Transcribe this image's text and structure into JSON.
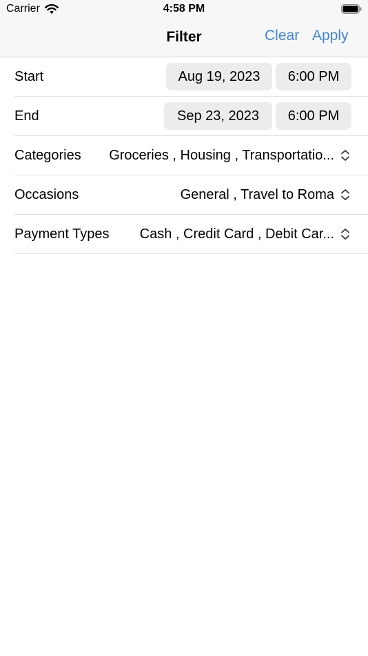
{
  "status": {
    "carrier": "Carrier",
    "time": "4:58 PM"
  },
  "nav": {
    "title": "Filter",
    "clear_label": "Clear",
    "apply_label": "Apply"
  },
  "rows": {
    "start": {
      "label": "Start",
      "date": "Aug 19, 2023",
      "time": "6:00 PM"
    },
    "end": {
      "label": "End",
      "date": "Sep 23, 2023",
      "time": "6:00 PM"
    },
    "categories": {
      "label": "Categories",
      "value": "Groceries , Housing , Transportatio..."
    },
    "occasions": {
      "label": "Occasions",
      "value": "General , Travel to Roma"
    },
    "payment_types": {
      "label": "Payment Types",
      "value": "Cash , Credit Card , Debit Car..."
    }
  },
  "colors": {
    "accent": "#3d84e6",
    "pill_bg": "#ececef",
    "bar_bg": "#f7f7f7"
  }
}
